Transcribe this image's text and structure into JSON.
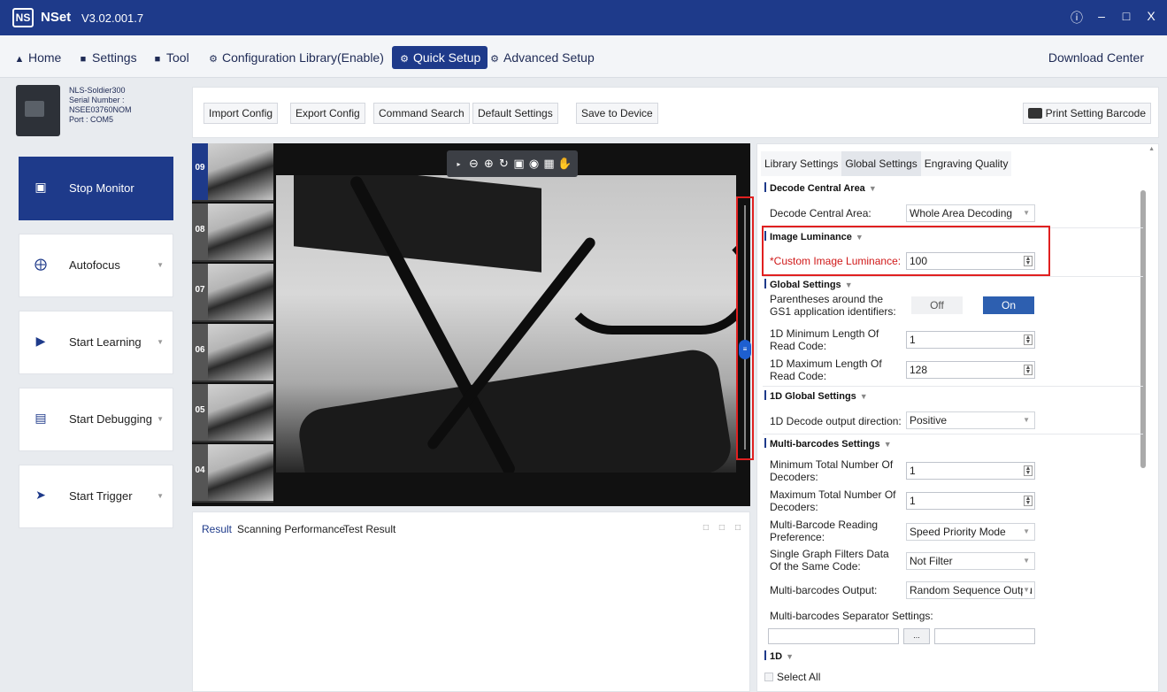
{
  "titlebar": {
    "logo": "NS",
    "app_name": "NSet",
    "version": "V3.02.001.7",
    "controls": [
      "ⓘ",
      "–",
      "□",
      "X"
    ]
  },
  "menu": {
    "home": "Home",
    "settings": "Settings",
    "tool": "Tool",
    "config_library": "Configuration Library(Enable)",
    "quick_setup": "Quick Setup",
    "advanced_setup": "Advanced Setup",
    "download_center": "Download Center"
  },
  "device": {
    "model": "NLS-Soldier300",
    "serial_label": "Serial Number :",
    "serial": "NSEE03760NOM",
    "port": "Port : COM5"
  },
  "toolbar": {
    "import": "Import Config",
    "export": "Export Config",
    "command": "Command Search",
    "default": "Default Settings",
    "save": "Save to Device",
    "print": "Print Setting Barcode"
  },
  "sidebar": {
    "items": [
      {
        "label": "Stop Monitor",
        "icon": "monitor-icon"
      },
      {
        "label": "Autofocus",
        "icon": "crosshair-icon"
      },
      {
        "label": "Start Learning",
        "icon": "play-icon"
      },
      {
        "label": "Start Debugging",
        "icon": "debug-icon"
      },
      {
        "label": "Start Trigger",
        "icon": "trigger-icon"
      }
    ]
  },
  "thumbnails": [
    "09",
    "08",
    "07",
    "06",
    "05",
    "04"
  ],
  "results": {
    "tabs": [
      "Result",
      "Scanning Performance",
      "Test Result"
    ]
  },
  "settings": {
    "tabs": [
      "Library Settings",
      "Global Settings",
      "Engraving Quality"
    ],
    "decode_central": {
      "header": "Decode Central Area",
      "label": "Decode Central Area:",
      "value": "Whole Area Decoding"
    },
    "image_luminance": {
      "header": "Image Luminance",
      "label": "*Custom Image Luminance:",
      "value": "100"
    },
    "global": {
      "header": "Global Settings",
      "gs1_label": "Parentheses around the GS1 application identifiers:",
      "off": "Off",
      "on": "On",
      "min_len_label": "1D Minimum Length Of Read Code:",
      "min_len_value": "1",
      "max_len_label": "1D Maximum Length Of Read Code:",
      "max_len_value": "128"
    },
    "global_1d": {
      "header": "1D Global Settings",
      "dir_label": "1D Decode output direction:",
      "dir_value": "Positive"
    },
    "multi": {
      "header": "Multi-barcodes Settings",
      "min_total_label": "Minimum Total Number Of Decoders:",
      "min_total_value": "1",
      "max_total_label": "Maximum Total Number Of Decoders:",
      "max_total_value": "1",
      "pref_label": "Multi-Barcode Reading Preference:",
      "pref_value": "Speed Priority Mode",
      "filter_label": "Single Graph Filters Data Of the Same Code:",
      "filter_value": "Not Filter",
      "output_label": "Multi-barcodes Output:",
      "output_value": "Random Sequence Outpu",
      "sep_label": "Multi-barcodes Separator Settings:",
      "sep_btn": "..."
    },
    "oned": {
      "header": "1D",
      "select_all": "Select All"
    }
  }
}
